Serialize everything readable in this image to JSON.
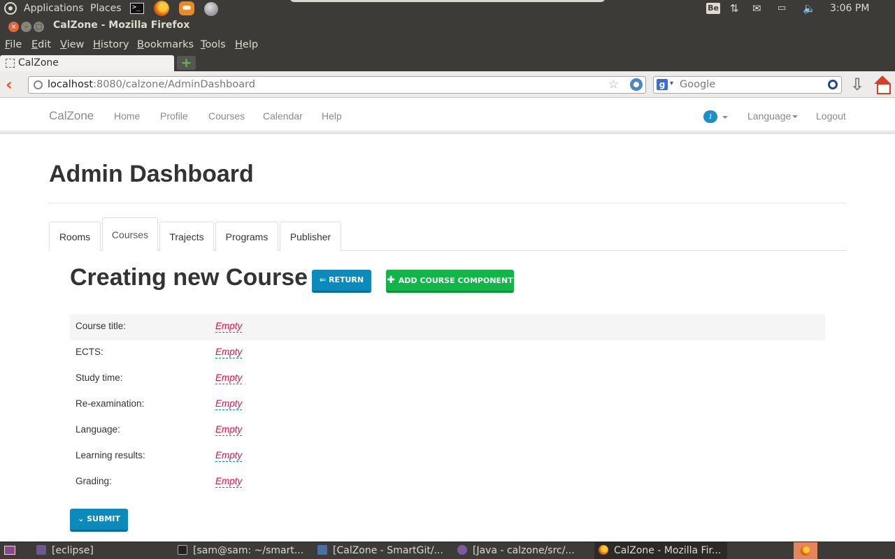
{
  "desktop_panel": {
    "applications": "Applications",
    "places": "Places",
    "be_label": "Be",
    "clock": "3:06 PM"
  },
  "window": {
    "title": "CalZone - Mozilla Firefox"
  },
  "firefox_menu": [
    "File",
    "Edit",
    "View",
    "History",
    "Bookmarks",
    "Tools",
    "Help"
  ],
  "browser": {
    "tab_title": "CalZone",
    "url_host": "localhost",
    "url_rest": ":8080/calzone/AdminDashboard",
    "search_placeholder": "Google"
  },
  "site_nav": {
    "brand": "CalZone",
    "links": [
      "Home",
      "Profile",
      "Courses",
      "Calendar",
      "Help"
    ],
    "notification_count": "1",
    "language": "Language",
    "logout": "Logout"
  },
  "page": {
    "title": "Admin Dashboard",
    "tabs": [
      {
        "label": "Rooms",
        "active": false
      },
      {
        "label": "Courses",
        "active": true
      },
      {
        "label": "Trajects",
        "active": false
      },
      {
        "label": "Programs",
        "active": false
      },
      {
        "label": "Publisher",
        "active": false
      }
    ],
    "section_title": "Creating new Course",
    "return_label": "RETURN",
    "add_component_label": "ADD COURSE COMPONENT",
    "fields": [
      {
        "label": "Course title:",
        "value": "Empty"
      },
      {
        "label": "ECTS:",
        "value": "Empty"
      },
      {
        "label": "Study time:",
        "value": "Empty"
      },
      {
        "label": "Re-examination:",
        "value": "Empty"
      },
      {
        "label": "Language:",
        "value": "Empty"
      },
      {
        "label": "Learning results:",
        "value": "Empty"
      },
      {
        "label": "Grading:",
        "value": "Empty"
      }
    ],
    "submit_label": "SUBMIT"
  },
  "taskbar": {
    "items": [
      {
        "label": "[eclipse]",
        "icon": "eclipse-icon"
      },
      {
        "label": "[sam@sam: ~/smart...",
        "icon": "terminal-icon"
      },
      {
        "label": "[CalZone - SmartGit/...",
        "icon": "smartgit-icon"
      },
      {
        "label": "[Java - calzone/src/...",
        "icon": "java-icon"
      },
      {
        "label": "CalZone - Mozilla Fir...",
        "icon": "firefox-icon"
      }
    ]
  },
  "colors": {
    "panel": "#3c3b37",
    "primary_button": "#0d8abc",
    "success_button": "#12b548",
    "empty_value": "#dd1144"
  }
}
